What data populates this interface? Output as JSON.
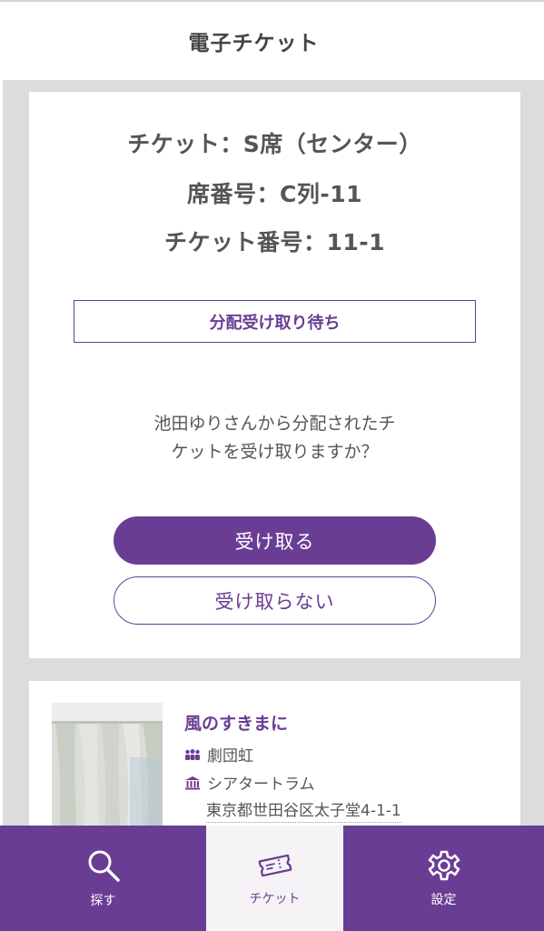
{
  "header": {
    "title": "電子チケット"
  },
  "ticket": {
    "type_line": "チケット：S席（センター）",
    "seat_line": "席番号：C列-11",
    "number_line": "チケット番号：11-1",
    "status": "分配受け取り待ち",
    "message_line1": "池田ゆりさんから分配されたチ",
    "message_line2": "ケットを受け取りますか？",
    "accept_label": "受け取る",
    "decline_label": "受け取らない"
  },
  "event": {
    "title": "風のすきまに",
    "troupe": "劇団虹",
    "venue": "シアタートラム",
    "address": "東京都世田谷区太子堂4-1-1"
  },
  "tabbar": {
    "tabs": [
      {
        "label": "探す",
        "icon": "search-icon",
        "active": false
      },
      {
        "label": "チケット",
        "icon": "ticket-icon",
        "active": true
      },
      {
        "label": "設定",
        "icon": "gear-icon",
        "active": false
      }
    ]
  },
  "colors": {
    "accent": "#6a3d94",
    "background": "#dcdbde",
    "active_tab_bg": "#f5f3f6"
  }
}
